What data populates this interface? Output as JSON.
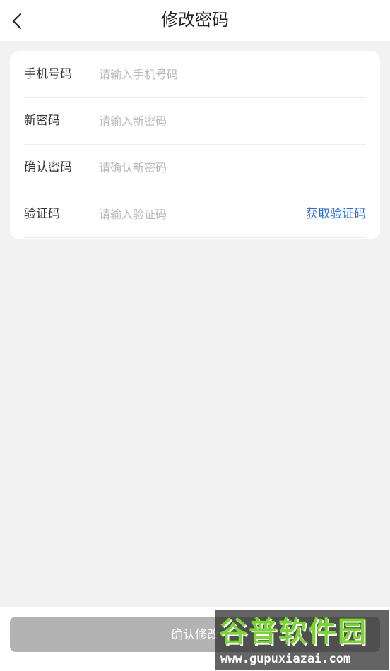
{
  "header": {
    "title": "修改密码",
    "back_icon": "chevron-left-icon"
  },
  "form": {
    "rows": [
      {
        "label": "手机号码",
        "placeholder": "请输入手机号码",
        "value": ""
      },
      {
        "label": "新密码",
        "placeholder": "请输入新密码",
        "value": ""
      },
      {
        "label": "确认密码",
        "placeholder": "请确认新密码",
        "value": ""
      },
      {
        "label": "验证码",
        "placeholder": "请输入验证码",
        "value": ""
      }
    ],
    "get_code_label": "获取验证码"
  },
  "footer": {
    "confirm_label": "确认修改"
  },
  "watermark": {
    "brand": "谷普软件园",
    "url": "www.gupuxiazai.com"
  },
  "colors": {
    "link_blue": "#2f6fd6",
    "button_disabled": "#b3b3b3",
    "page_bg": "#f2f2f2"
  }
}
